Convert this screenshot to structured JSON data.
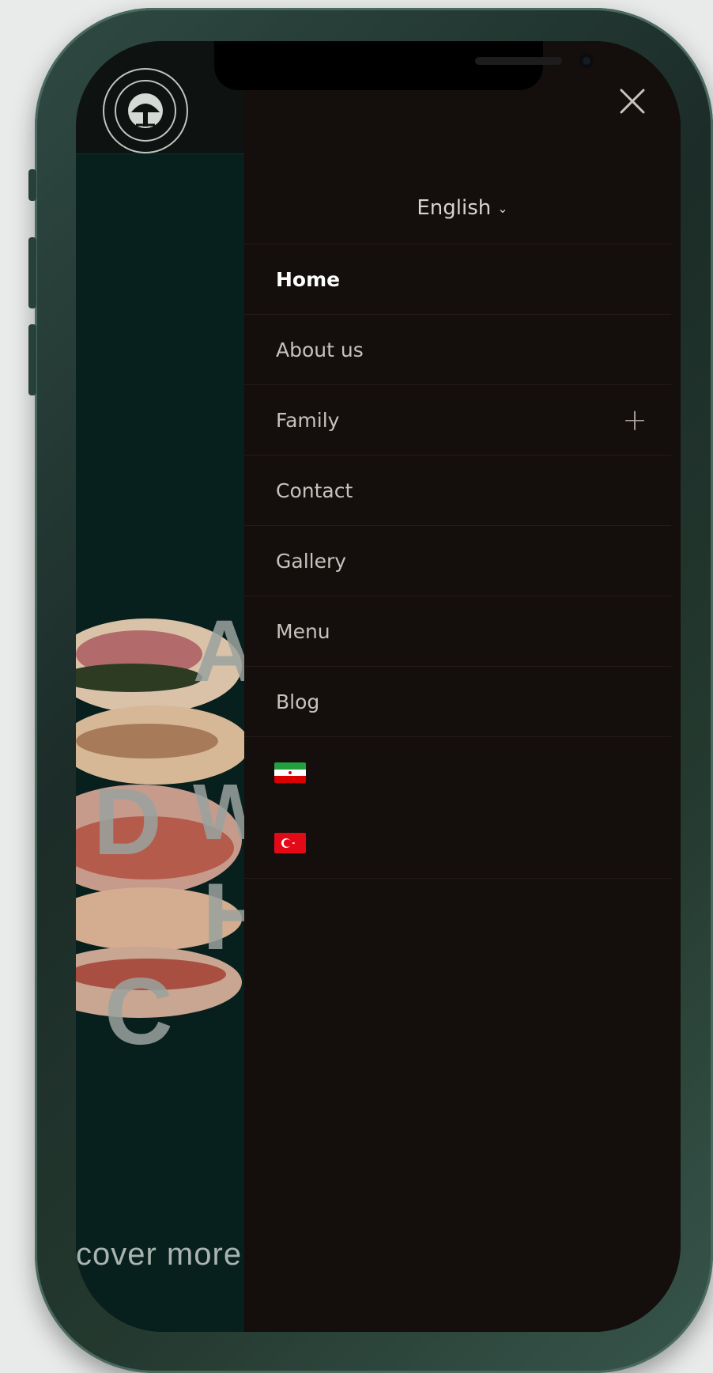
{
  "language_selector": {
    "label": "English",
    "chevron_icon": "chevron-down-icon"
  },
  "nav": {
    "items": [
      {
        "label": "Home",
        "active": true
      },
      {
        "label": "About us",
        "active": false
      },
      {
        "label": "Family",
        "active": false,
        "expandable": true
      },
      {
        "label": "Contact",
        "active": false
      },
      {
        "label": "Gallery",
        "active": false
      },
      {
        "label": "Menu",
        "active": false
      },
      {
        "label": "Blog",
        "active": false
      }
    ],
    "flags": [
      "iran-flag-icon",
      "turkey-flag-icon"
    ]
  },
  "close_icon": "close-icon",
  "background_page": {
    "hero_letters": [
      "A",
      "D",
      "W",
      "H",
      "C"
    ],
    "cta_text": "cover more"
  },
  "colors": {
    "drawer_bg": "#140e0c",
    "page_bg": "#07201d",
    "active_text": "#ffffff",
    "text": "#c8c2bf"
  }
}
